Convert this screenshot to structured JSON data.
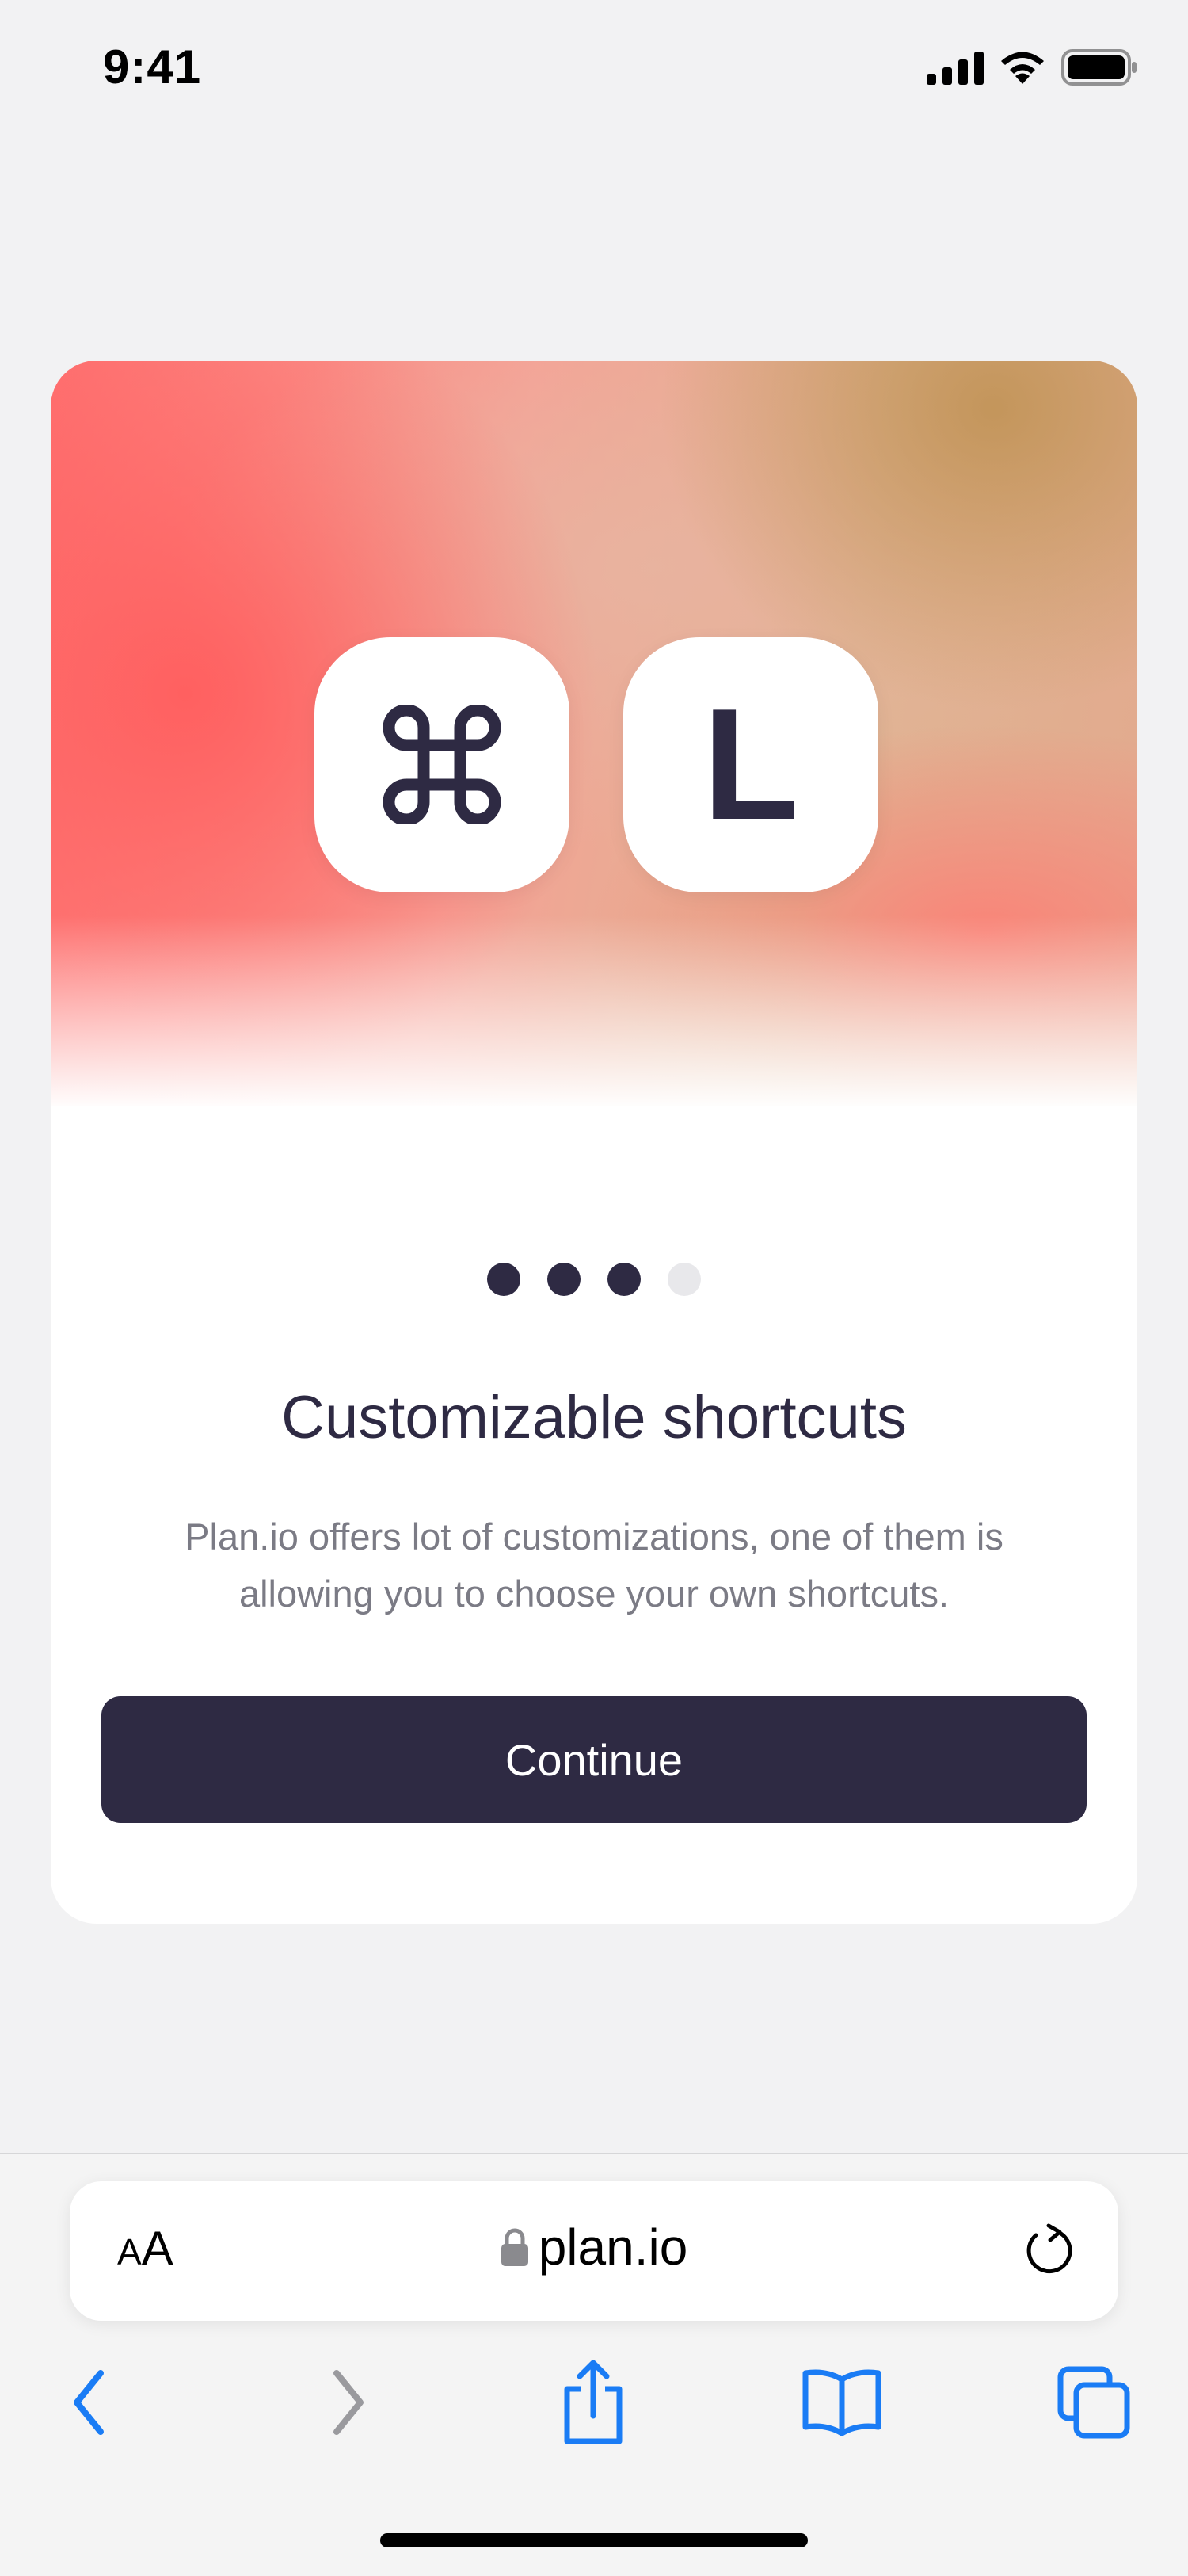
{
  "status_bar": {
    "time": "9:41"
  },
  "card": {
    "keys": [
      {
        "label": "⌘",
        "icon": "command-key-icon"
      },
      {
        "label": "L"
      }
    ],
    "pagination": {
      "total": 4,
      "active_count": 3
    },
    "title": "Customizable shortcuts",
    "description": "Plan.io offers lot of customizations, one of them is allowing you to choose your own shortcuts.",
    "continue_label": "Continue"
  },
  "browser": {
    "text_size_small": "A",
    "text_size_large": "A",
    "url": "plan.io",
    "icons": {
      "lock": "lock-icon",
      "reload": "reload-icon",
      "back": "back-chevron-icon",
      "forward": "forward-chevron-icon",
      "share": "share-icon",
      "bookmarks": "bookmarks-icon",
      "tabs": "tabs-icon"
    }
  },
  "colors": {
    "accent_dark": "#2e2a43",
    "link_blue": "#1a7cf5",
    "background": "#f2f2f3"
  }
}
